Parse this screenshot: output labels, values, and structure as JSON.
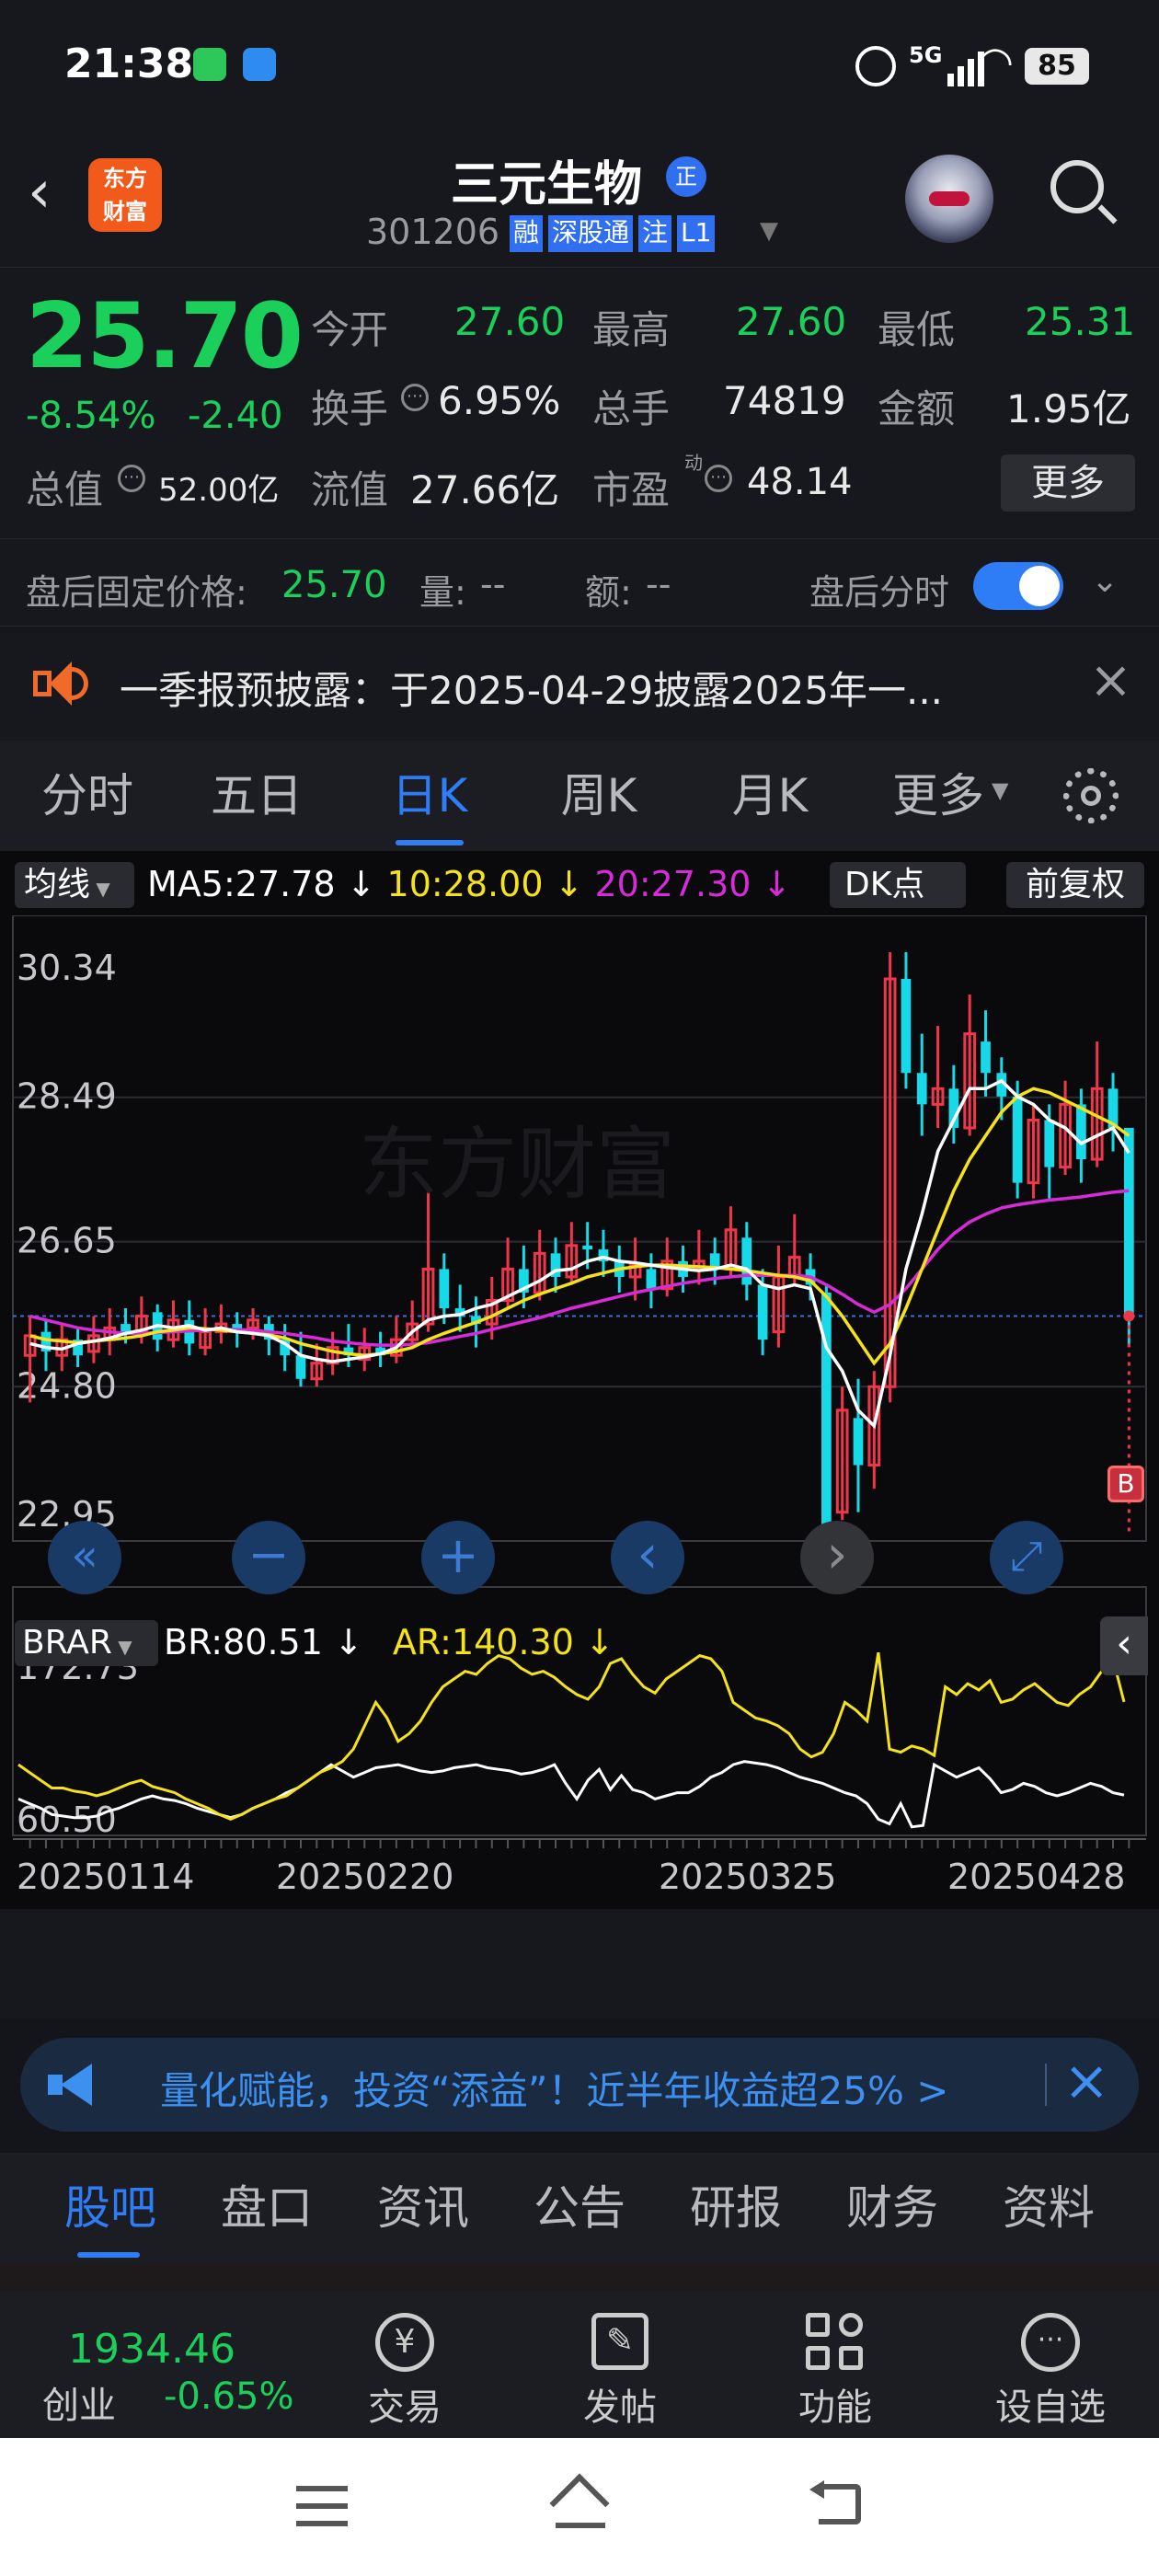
{
  "status_bar": {
    "time": "21:38",
    "battery": "85",
    "signal": "5G"
  },
  "header": {
    "title": "三元生物",
    "title_badge": "正",
    "code": "301206",
    "tags": [
      "融",
      "深股通",
      "注",
      "L1"
    ],
    "logo_text_1": "东方",
    "logo_text_2": "财富"
  },
  "quote": {
    "price": "25.70",
    "change_pct": "-8.54%",
    "change": "-2.40",
    "open_label": "今开",
    "open": "27.60",
    "high_label": "最高",
    "high": "27.60",
    "low_label": "最低",
    "low": "25.31",
    "turnover_label": "换手",
    "turnover": "6.95%",
    "volume_label": "总手",
    "volume": "74819",
    "amount_label": "金额",
    "amount": "1.95亿",
    "mktcap_label": "总值",
    "mktcap": "52.00亿",
    "float_label": "流值",
    "float": "27.66亿",
    "pe_label": "市盈",
    "pe_sup": "动",
    "pe": "48.14",
    "more_label": "更多",
    "after_label": "盘后固定价格:",
    "after_price": "25.70",
    "after_vol_label": "量:",
    "after_vol": "--",
    "after_amt_label": "额:",
    "after_amt": "--",
    "after_toggle_label": "盘后分时"
  },
  "notice": {
    "text": "一季报预披露：于2025-04-29披露2025年一..."
  },
  "tabs": {
    "items": [
      "分时",
      "五日",
      "日K",
      "周K",
      "月K",
      "更多"
    ],
    "active_index": 2
  },
  "chart_header": {
    "ma_button": "均线",
    "ma5": "MA5:27.78",
    "ma10": "10:28.00",
    "ma20": "20:27.30",
    "dk_button": "DK点",
    "adjust_button": "前复权"
  },
  "indicator_header": {
    "name": "BRAR",
    "br": "BR:80.51",
    "ar": "AR:140.30"
  },
  "chart_data": [
    {
      "type": "candlestick",
      "ylim": [
        22.95,
        30.34
      ],
      "y_tick_labels": [
        "30.34",
        "28.49",
        "26.65",
        "24.80",
        "22.95"
      ],
      "x_tick_labels": [
        "20250114",
        "20250220",
        "20250325",
        "20250428"
      ],
      "series": [
        {
          "name": "MA5",
          "value": 27.78
        },
        {
          "name": "10",
          "value": 28.0
        },
        {
          "name": "20",
          "value": 27.3
        }
      ],
      "candles": [
        [
          25.2,
          25.45,
          25.7,
          24.6
        ],
        [
          25.5,
          25.25,
          25.65,
          25.0
        ],
        [
          25.2,
          25.4,
          25.6,
          25.0
        ],
        [
          25.4,
          25.2,
          25.55,
          25.05
        ],
        [
          25.25,
          25.45,
          25.7,
          25.1
        ],
        [
          25.4,
          25.55,
          25.8,
          25.2
        ],
        [
          25.6,
          25.5,
          25.8,
          25.35
        ],
        [
          25.5,
          25.7,
          25.95,
          25.35
        ],
        [
          25.75,
          25.4,
          25.85,
          25.25
        ],
        [
          25.4,
          25.65,
          25.9,
          25.3
        ],
        [
          25.65,
          25.35,
          25.9,
          25.2
        ],
        [
          25.3,
          25.5,
          25.8,
          25.2
        ],
        [
          25.5,
          25.6,
          25.85,
          25.35
        ],
        [
          25.6,
          25.5,
          25.75,
          25.3
        ],
        [
          25.55,
          25.65,
          25.8,
          25.4
        ],
        [
          25.6,
          25.4,
          25.7,
          25.2
        ],
        [
          25.4,
          25.2,
          25.6,
          25.0
        ],
        [
          25.2,
          24.9,
          25.5,
          24.8
        ],
        [
          24.9,
          25.1,
          25.35,
          24.8
        ],
        [
          25.1,
          25.3,
          25.5,
          24.95
        ],
        [
          25.3,
          25.2,
          25.6,
          25.05
        ],
        [
          25.15,
          25.3,
          25.55,
          25.0
        ],
        [
          25.3,
          25.2,
          25.5,
          25.05
        ],
        [
          25.2,
          25.4,
          25.7,
          25.1
        ],
        [
          25.4,
          25.6,
          25.9,
          25.3
        ],
        [
          25.6,
          26.3,
          27.3,
          25.5
        ],
        [
          26.3,
          25.8,
          26.5,
          25.6
        ],
        [
          25.8,
          25.7,
          26.1,
          25.5
        ],
        [
          25.7,
          25.6,
          25.95,
          25.3
        ],
        [
          25.6,
          25.9,
          26.2,
          25.4
        ],
        [
          25.9,
          26.3,
          26.7,
          25.8
        ],
        [
          26.3,
          26.0,
          26.6,
          25.8
        ],
        [
          26.0,
          26.5,
          26.8,
          25.9
        ],
        [
          26.5,
          26.2,
          26.7,
          26.0
        ],
        [
          26.2,
          26.6,
          26.9,
          26.1
        ],
        [
          26.6,
          26.55,
          26.9,
          26.3
        ],
        [
          26.55,
          26.4,
          26.8,
          26.2
        ],
        [
          26.4,
          26.2,
          26.6,
          26.0
        ],
        [
          26.2,
          26.35,
          26.7,
          25.9
        ],
        [
          26.3,
          26.05,
          26.5,
          25.8
        ],
        [
          26.05,
          26.4,
          26.7,
          25.95
        ],
        [
          26.4,
          26.2,
          26.6,
          26.0
        ],
        [
          26.3,
          26.4,
          26.8,
          26.1
        ],
        [
          26.5,
          26.3,
          26.7,
          26.1
        ],
        [
          26.3,
          26.8,
          27.1,
          26.2
        ],
        [
          26.7,
          26.1,
          26.9,
          25.9
        ],
        [
          26.1,
          25.4,
          26.3,
          25.2
        ],
        [
          25.5,
          26.2,
          26.6,
          25.3
        ],
        [
          26.2,
          26.45,
          27.0,
          26.1
        ],
        [
          26.3,
          26.1,
          26.5,
          25.9
        ],
        [
          26.0,
          23.0,
          26.1,
          22.95
        ],
        [
          23.2,
          24.5,
          24.8,
          23.1
        ],
        [
          24.4,
          23.8,
          24.9,
          23.2
        ],
        [
          23.8,
          24.8,
          25.0,
          23.5
        ],
        [
          24.8,
          30.0,
          30.34,
          24.6
        ],
        [
          30.0,
          28.8,
          30.34,
          28.6
        ],
        [
          28.8,
          28.4,
          29.3,
          28.0
        ],
        [
          28.4,
          28.6,
          29.4,
          28.1
        ],
        [
          28.6,
          28.1,
          28.9,
          27.9
        ],
        [
          28.1,
          29.3,
          29.8,
          28.0
        ],
        [
          29.2,
          28.8,
          29.6,
          28.5
        ],
        [
          28.8,
          28.5,
          29.0,
          28.2
        ],
        [
          28.5,
          27.4,
          28.7,
          27.2
        ],
        [
          27.4,
          28.2,
          28.4,
          27.2
        ],
        [
          28.2,
          27.6,
          28.4,
          27.2
        ],
        [
          27.6,
          28.4,
          28.7,
          27.5
        ],
        [
          28.4,
          27.7,
          28.6,
          27.4
        ],
        [
          27.7,
          28.6,
          29.2,
          27.6
        ],
        [
          28.6,
          28.1,
          28.8,
          27.8
        ],
        [
          28.1,
          25.7,
          28.1,
          25.31
        ]
      ],
      "ma5_points": [
        25.35,
        25.3,
        25.28,
        25.35,
        25.38,
        25.42,
        25.48,
        25.52,
        25.58,
        25.55,
        25.58,
        25.52,
        25.55,
        25.5,
        25.48,
        25.45,
        25.35,
        25.2,
        25.15,
        25.12,
        25.15,
        25.18,
        25.22,
        25.3,
        25.5,
        25.65,
        25.7,
        25.72,
        25.8,
        25.85,
        25.95,
        26.05,
        26.15,
        26.28,
        26.3,
        26.4,
        26.45,
        26.4,
        26.38,
        26.35,
        26.32,
        26.3,
        26.28,
        26.3,
        26.35,
        26.3,
        26.1,
        26.05,
        26.1,
        26.05,
        25.3,
        25.0,
        24.5,
        24.3,
        25.2,
        26.3,
        27.0,
        27.8,
        28.2,
        28.6,
        28.6,
        28.7,
        28.5,
        28.4,
        28.2,
        28.1,
        27.9,
        28.0,
        28.1,
        27.78
      ],
      "ma10_points": [
        25.45,
        25.4,
        25.38,
        25.36,
        25.38,
        25.4,
        25.42,
        25.45,
        25.5,
        25.52,
        25.55,
        25.54,
        25.52,
        25.5,
        25.48,
        25.46,
        25.42,
        25.35,
        25.3,
        25.25,
        25.22,
        25.2,
        25.22,
        25.25,
        25.3,
        25.4,
        25.48,
        25.55,
        25.62,
        25.7,
        25.8,
        25.9,
        25.98,
        26.05,
        26.12,
        26.2,
        26.25,
        26.3,
        26.33,
        26.35,
        26.35,
        26.34,
        26.33,
        26.32,
        26.3,
        26.28,
        26.25,
        26.22,
        26.2,
        26.15,
        25.95,
        25.7,
        25.4,
        25.1,
        25.35,
        25.8,
        26.3,
        26.8,
        27.3,
        27.7,
        28.0,
        28.3,
        28.5,
        28.6,
        28.55,
        28.45,
        28.35,
        28.25,
        28.15,
        28.0
      ],
      "ma20_points": [
        25.7,
        25.65,
        25.6,
        25.55,
        25.52,
        25.5,
        25.48,
        25.48,
        25.49,
        25.5,
        25.51,
        25.52,
        25.53,
        25.53,
        25.52,
        25.5,
        25.48,
        25.45,
        25.42,
        25.38,
        25.36,
        25.34,
        25.33,
        25.33,
        25.34,
        25.36,
        25.4,
        25.44,
        25.48,
        25.53,
        25.58,
        25.63,
        25.68,
        25.74,
        25.8,
        25.85,
        25.9,
        25.95,
        26.0,
        26.04,
        26.08,
        26.12,
        26.15,
        26.18,
        26.2,
        26.22,
        26.22,
        26.22,
        26.22,
        26.2,
        26.1,
        25.98,
        25.85,
        25.75,
        25.85,
        26.05,
        26.3,
        26.55,
        26.75,
        26.9,
        27.0,
        27.08,
        27.12,
        27.15,
        27.18,
        27.2,
        27.22,
        27.25,
        27.28,
        27.3
      ]
    },
    {
      "type": "line",
      "title": "BRAR",
      "ylim": [
        60.5,
        172.73
      ],
      "y_tick_labels": [
        "172.73",
        "60.50"
      ],
      "series": [
        {
          "name": "BR",
          "value": 80.51,
          "color": "#ffffff",
          "values": [
            78,
            75,
            72,
            68,
            67,
            66,
            66,
            67,
            70,
            72,
            75,
            78,
            80,
            78,
            77,
            75,
            72,
            70,
            68,
            66,
            68,
            72,
            75,
            78,
            82,
            85,
            90,
            95,
            100,
            96,
            92,
            95,
            98,
            99,
            100,
            98,
            96,
            95,
            96,
            98,
            99,
            100,
            98,
            97,
            96,
            94,
            95,
            97,
            100,
            88,
            78,
            90,
            97,
            84,
            93,
            84,
            82,
            78,
            80,
            82,
            82,
            86,
            92,
            95,
            100,
            102,
            101,
            100,
            98,
            95,
            92,
            90,
            88,
            85,
            82,
            80,
            75,
            65,
            62,
            75,
            60,
            61,
            100,
            96,
            92,
            95,
            98,
            91,
            82,
            84,
            88,
            86,
            82,
            80,
            82,
            85,
            88,
            86,
            82,
            80.5
          ]
        },
        {
          "name": "AR",
          "value": 140.3,
          "color": "#f5e21b",
          "values": [
            100,
            95,
            90,
            85,
            85,
            83,
            82,
            80,
            82,
            85,
            88,
            90,
            86,
            84,
            82,
            78,
            75,
            72,
            68,
            65,
            68,
            72,
            75,
            78,
            80,
            85,
            90,
            95,
            98,
            102,
            110,
            125,
            140,
            130,
            115,
            120,
            128,
            140,
            150,
            155,
            160,
            158,
            165,
            170,
            168,
            162,
            158,
            160,
            156,
            150,
            145,
            142,
            150,
            165,
            168,
            158,
            150,
            146,
            155,
            160,
            165,
            170,
            168,
            160,
            140,
            135,
            130,
            128,
            125,
            120,
            110,
            105,
            108,
            120,
            140,
            135,
            128,
            172,
            110,
            108,
            112,
            110,
            106,
            150,
            145,
            152,
            148,
            154,
            140,
            142,
            148,
            152,
            146,
            140,
            138,
            145,
            150,
            160,
            168,
            140.3
          ]
        }
      ]
    }
  ],
  "chart_controls": [
    "«",
    "−",
    "+",
    "‹",
    "›",
    "⤢"
  ],
  "chart_marker": "B",
  "banner": {
    "text": "量化赋能，投资“添益”！近半年收益超25% >"
  },
  "subtabs": {
    "items": [
      "股吧",
      "盘口",
      "资讯",
      "公告",
      "研报",
      "财务",
      "资料"
    ],
    "active_index": 0
  },
  "bottombar": {
    "index_value": "1934.46",
    "index_name": "创业",
    "index_change": "-0.65%",
    "items": [
      "交易",
      "发帖",
      "功能",
      "设自选"
    ]
  },
  "colors": {
    "up": "#f0364a",
    "down": "#1ad05a",
    "cyan_candle": "#17d9e8",
    "accent": "#2f7df6",
    "ma5": "#ffffff",
    "ma10": "#f5e21b",
    "ma20": "#d62bd6"
  }
}
